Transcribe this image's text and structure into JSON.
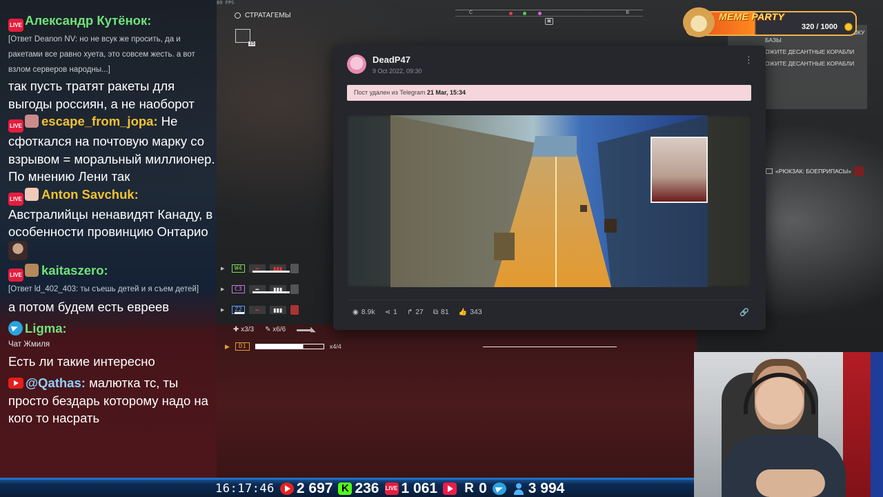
{
  "game": {
    "fps": "89 FPS",
    "stratagem_header": "СТРАТАГЕМЫ",
    "stratagem_slot_sub": "15",
    "compass_letters": [
      "С",
      "В"
    ],
    "weapons": [
      {
        "code": "W4",
        "color": "#7ed957"
      },
      {
        "code": "C3",
        "color": "#c07ad9"
      },
      {
        "code": "Z2",
        "color": "#5aa0ff"
      }
    ],
    "ammo": {
      "grenades": "x3/3",
      "stims": "x6/6"
    },
    "primary": {
      "code": "D1",
      "mags": "x4/4",
      "fill": 0.7
    },
    "objectives": [
      "ОЖИТЕ ДИСПЕТЧЕРСКУЮ ВЫШКУ БАЗЫ",
      "ОЖИТЕ ДЕСАНТНЫЕ КОРАБЛИ",
      "ОЖИТЕ ДЕСАНТНЫЕ КОРАБЛИ"
    ],
    "backpack_prompt": "«РЮКЗАК: БОЕПРИПАСЫ»"
  },
  "chat": {
    "messages": [
      {
        "author": "Александр Кутёнок:",
        "author_color": "#6fe37a",
        "reply": "[Ответ Deanon NV: но не всук же просить, да и ракетами все равно хуета, это совсем жесть. а вот взлом серверов народны...]",
        "text": "так пусть тратят ракеты для выгоды россиян, а не наоборот",
        "platform": "vk-live"
      },
      {
        "author": "escape_from_jopa:",
        "author_color": "#f2c230",
        "text": "Не сфоткался на почтовую марку со взрывом = моральный миллионер. По мнению Лени так",
        "platform": "vk-live"
      },
      {
        "author": "Anton Savchuk:",
        "author_color": "#f2c230",
        "text": "Австралийцы ненавидят Канаду, в особенности провинцию Онтарио",
        "platform": "vk-live"
      },
      {
        "author": "kaitaszero:",
        "author_color": "#6fe37a",
        "reply": "[Ответ ld_402_403: ты съешь детей и я съем детей]",
        "text": "а потом будем есть евреев",
        "platform": "vk-live"
      },
      {
        "author": "Ligma:",
        "author_color": "#6fe37a",
        "sub": "Чат Жмиля",
        "text": "Есть ли такие интересно",
        "platform": "telegram"
      },
      {
        "author": "@Qathas:",
        "author_color": "#8fd0ff",
        "text": "малютка тс, ты просто бездарь которому надо на кого то насрать",
        "platform": "youtube"
      }
    ],
    "live_label": "LIVE"
  },
  "stats": {
    "time": "16:17:46",
    "youtube": "2 697",
    "kick": "236",
    "vklive": "1 061",
    "rutube_play": "",
    "rumble": "0",
    "telegram": "",
    "viewers": "3 994"
  },
  "post": {
    "author": "DeadP47",
    "date": "9 Oct 2022, 09:30",
    "deleted_prefix": "Пост удален из Telegram",
    "deleted_date": "21 Mar, 15:34",
    "views": "8.9k",
    "shares": "1",
    "forwards": "27",
    "comments": "81",
    "likes": "343"
  },
  "meme": {
    "title": "MEME PARTY",
    "count": "320 / 1000"
  }
}
